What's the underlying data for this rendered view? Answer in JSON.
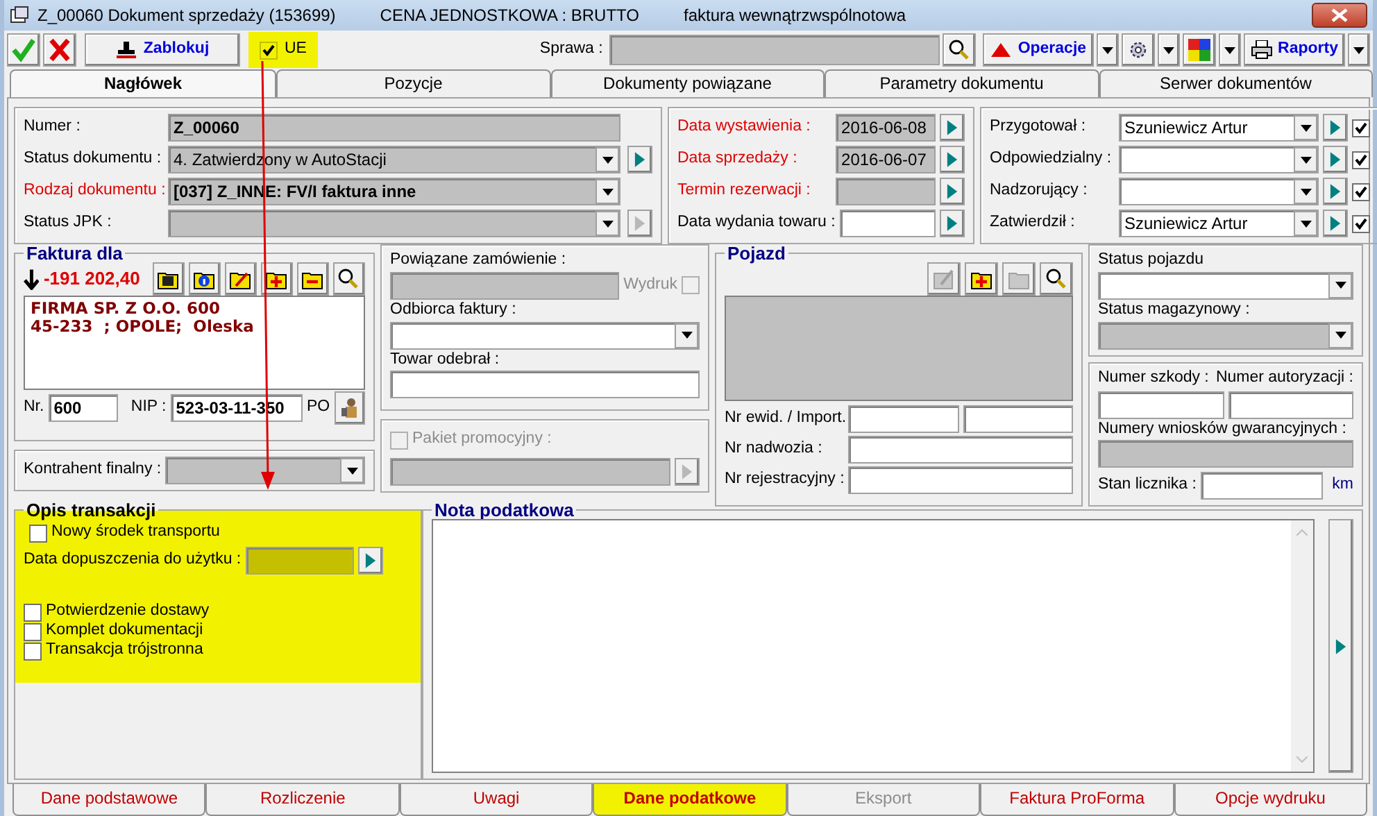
{
  "window": {
    "title_parts": [
      "Z_00060  Dokument sprzedaży (153699)",
      "CENA JEDNOSTKOWA : BRUTTO",
      "faktura wewnątrzwspólnotowa"
    ]
  },
  "toolbar": {
    "zablokuj": "Zablokuj",
    "ue": {
      "label": "UE",
      "checked": true,
      "highlighted": true
    },
    "sprawa_label": "Sprawa :",
    "operacje": "Operacje",
    "raporty": "Raporty"
  },
  "tabs": [
    {
      "label": "Nagłówek",
      "selected": true
    },
    {
      "label": "Pozycje",
      "selected": false
    },
    {
      "label": "Dokumenty powiązane",
      "selected": false
    },
    {
      "label": "Parametry dokumentu",
      "selected": false
    },
    {
      "label": "Serwer dokumentów",
      "selected": false
    }
  ],
  "document": [
    {
      "label": "Numer :",
      "value": "Z_00060",
      "kind": "text",
      "required": false,
      "bold": true
    },
    {
      "label": "Status dokumentu :",
      "value": "4. Zatwierdzony w AutoStacji",
      "kind": "combo",
      "required": false,
      "bold": false,
      "arrow_button": {
        "disabled": false
      }
    },
    {
      "label": "Rodzaj dokumentu :",
      "value": "[037] Z_INNE: FV/I faktura inne",
      "kind": "combo",
      "required": true,
      "bold": true
    },
    {
      "label": "Status JPK :",
      "kind": "combo",
      "required": false,
      "arrow_button": {
        "disabled": true
      }
    }
  ],
  "dates": [
    {
      "label": "Data wystawienia :",
      "value": "2016-06-08",
      "required": true,
      "readonly": true
    },
    {
      "label": "Data sprzedaży :",
      "value": "2016-06-07",
      "required": true,
      "readonly": true
    },
    {
      "label": "Termin rezerwacji :",
      "required": true,
      "readonly": true
    },
    {
      "label": "Data wydania towaru :",
      "required": false,
      "readonly": false
    }
  ],
  "people": [
    {
      "label": "Przygotował :",
      "value": "Szuniewicz Artur",
      "checked": true
    },
    {
      "label": "Odpowiedzialny :",
      "checked": true
    },
    {
      "label": "Nadzorujący :",
      "checked": true
    },
    {
      "label": "Zatwierdził :",
      "value": "Szuniewicz Artur",
      "checked": true
    }
  ],
  "invoice_for": {
    "title": "Faktura dla",
    "balance": "-191 202,40",
    "address": [
      "FIRMA SP. Z O.O. 600",
      "45-233  ; OPOLE;  Oleska"
    ],
    "nr_label": "Nr.",
    "nr": "600",
    "nip_label": "NIP :",
    "nip": "523-03-11-350",
    "po": "PO"
  },
  "final_contractor": {
    "label": "Kontrahent finalny :"
  },
  "order": {
    "label": "Powiązane zamówienie :",
    "print": {
      "label": "Wydruk",
      "checked": false,
      "disabled": true
    },
    "recipient_label": "Odbiorca faktury :",
    "received_label": "Towar odebrał :"
  },
  "promo": {
    "label": "Pakiet promocyjny :",
    "checked": false,
    "disabled": true
  },
  "vehicle": {
    "title": "Pojazd",
    "tools": [
      {
        "kind": "edit",
        "disabled": true
      },
      {
        "kind": "add",
        "disabled": false
      },
      {
        "kind": "folder",
        "disabled": true
      },
      {
        "kind": "search",
        "disabled": false
      }
    ],
    "reg_import_label": "Nr ewid. / Import.",
    "body_label": "Nr nadwozia :",
    "plate_label": "Nr rejestracyjny :"
  },
  "vehicle_status": {
    "status_label": "Status pojazdu",
    "stock_label": "Status magazynowy :"
  },
  "claims": {
    "claim_label": "Numer szkody :",
    "auth_label": "Numer autoryzacji :",
    "warranty_label": "Numery wniosków gwarancyjnych :",
    "odometer_label": "Stan licznika :",
    "unit": "km"
  },
  "transaction": {
    "title": "Opis transakcji",
    "highlighted": true,
    "new_vehicle": {
      "label": "Nowy środek transportu",
      "checked": false
    },
    "date_label": "Data dopuszczenia do użytku :",
    "checks": [
      {
        "label": "Potwierdzenie dostawy",
        "checked": false
      },
      {
        "label": "Komplet dokumentacji",
        "checked": false
      },
      {
        "label": "Transakcja trójstronna",
        "checked": false
      }
    ]
  },
  "tax_note": {
    "title": "Nota podatkowa"
  },
  "bottom_tabs": [
    {
      "label": "Dane podstawowe",
      "selected": false,
      "disabled": false,
      "highlighted": false
    },
    {
      "label": "Rozliczenie",
      "selected": false,
      "disabled": false,
      "highlighted": false
    },
    {
      "label": "Uwagi",
      "selected": false,
      "disabled": false,
      "highlighted": false
    },
    {
      "label": "Dane podatkowe",
      "selected": true,
      "disabled": false,
      "highlighted": true
    },
    {
      "label": "Eksport",
      "selected": false,
      "disabled": true,
      "highlighted": false
    },
    {
      "label": "Faktura ProForma",
      "selected": false,
      "disabled": false,
      "highlighted": false
    },
    {
      "label": "Opcje wydruku",
      "selected": false,
      "disabled": false,
      "highlighted": false
    }
  ]
}
